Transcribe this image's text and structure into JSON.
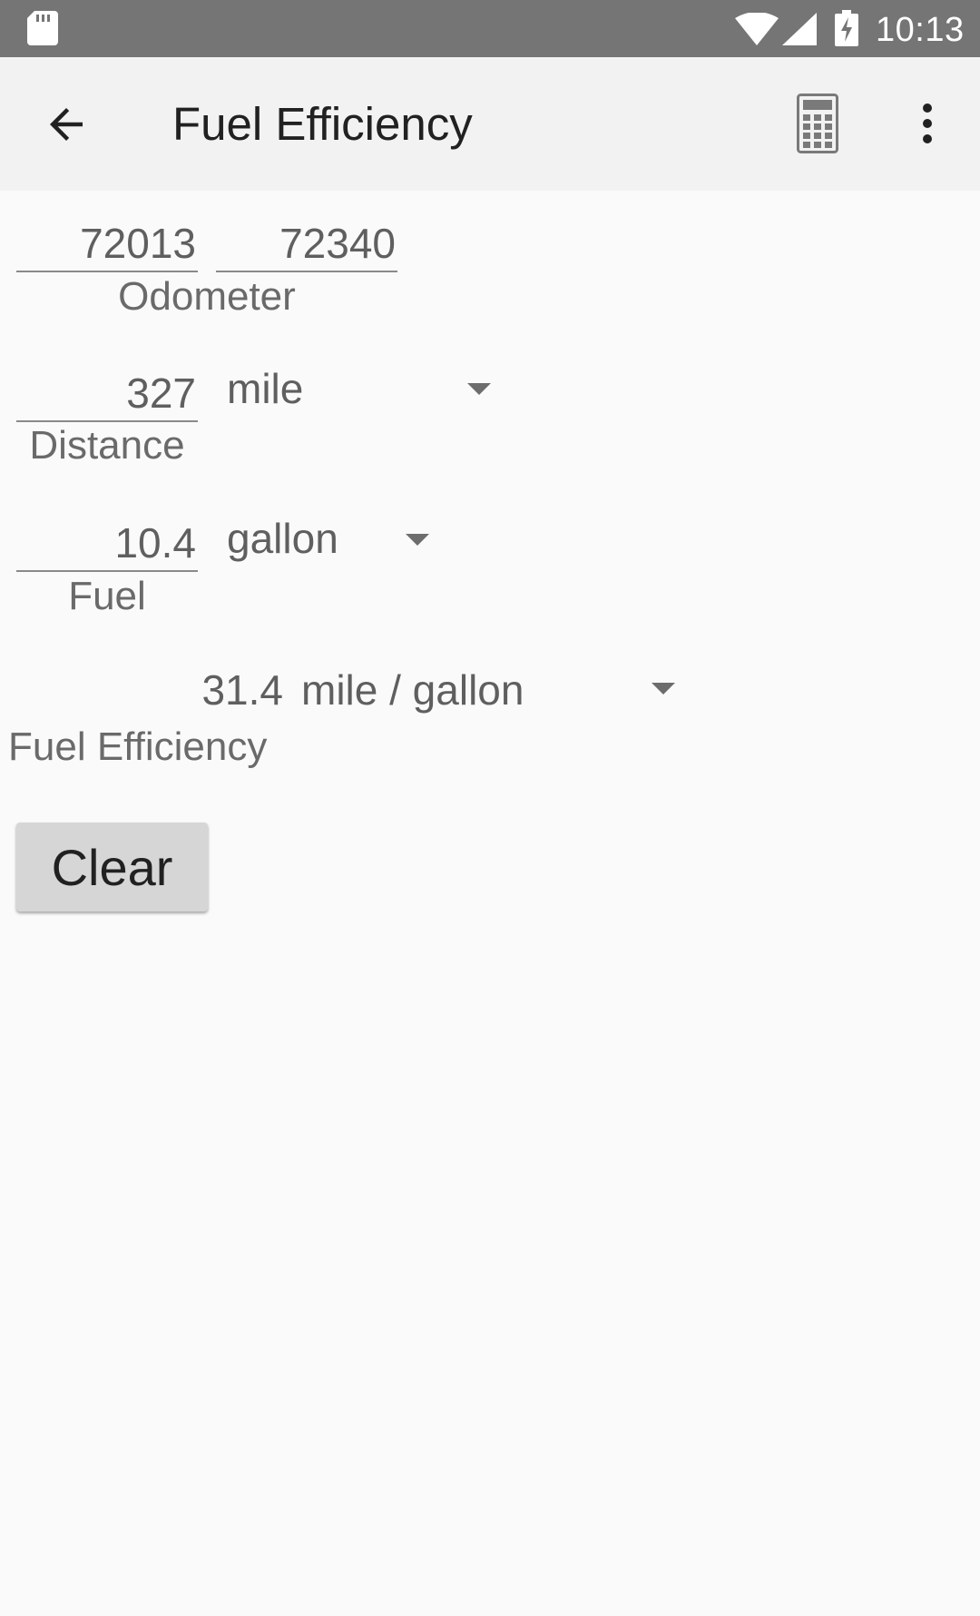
{
  "status_bar": {
    "time": "10:13"
  },
  "toolbar": {
    "title": "Fuel Efficiency",
    "back_icon": "arrow-back-icon",
    "calculator_icon": "calculator-icon",
    "more_icon": "more-vert-icon"
  },
  "odometer": {
    "start": "72013",
    "end": "72340",
    "label": "Odometer"
  },
  "distance": {
    "value": "327",
    "unit": "mile",
    "label": "Distance"
  },
  "fuel": {
    "value": "10.4",
    "unit": "gallon",
    "label": "Fuel"
  },
  "efficiency": {
    "value": "31.4",
    "unit": "mile / gallon",
    "label": "Fuel Efficiency"
  },
  "actions": {
    "clear_label": "Clear"
  },
  "colors": {
    "status_bar": "#757575",
    "app_bar": "#f2f2f2",
    "background": "#fafafa",
    "button": "#d6d6d6"
  }
}
